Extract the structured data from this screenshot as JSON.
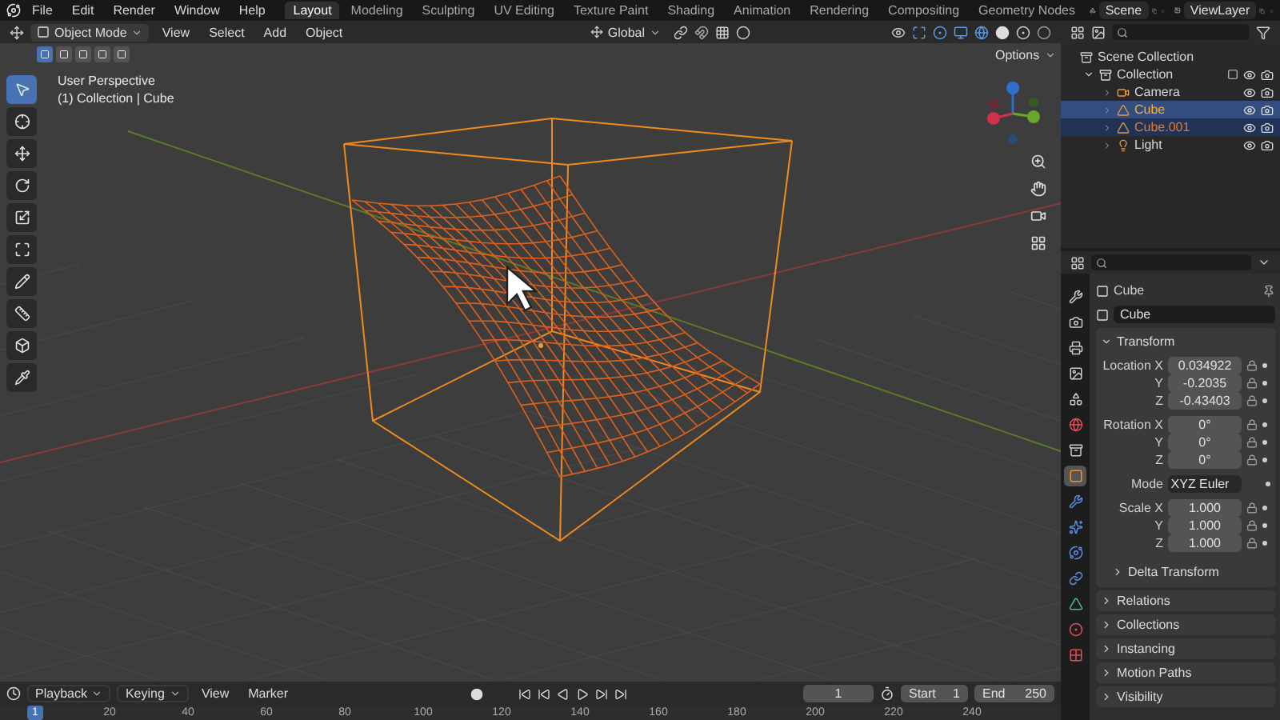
{
  "top_menu": [
    "File",
    "Edit",
    "Render",
    "Window",
    "Help"
  ],
  "workspaces": [
    {
      "label": "Layout",
      "selected": true
    },
    {
      "label": "Modeling",
      "selected": false
    },
    {
      "label": "Sculpting",
      "selected": false
    },
    {
      "label": "UV Editing",
      "selected": false
    },
    {
      "label": "Texture Paint",
      "selected": false
    },
    {
      "label": "Shading",
      "selected": false
    },
    {
      "label": "Animation",
      "selected": false
    },
    {
      "label": "Rendering",
      "selected": false
    },
    {
      "label": "Compositing",
      "selected": false
    },
    {
      "label": "Geometry Nodes",
      "selected": false
    }
  ],
  "scene": "Scene",
  "view_layer": "ViewLayer",
  "viewport_header": {
    "mode": "Object Mode",
    "menus": [
      "View",
      "Select",
      "Add",
      "Object"
    ],
    "orientation": "Global"
  },
  "select_modes": [
    {
      "selected": true
    },
    {
      "selected": false
    },
    {
      "selected": false
    },
    {
      "selected": false
    },
    {
      "selected": false
    }
  ],
  "options": "Options",
  "viewport_info": [
    "User Perspective",
    "(1) Collection | Cube"
  ],
  "tools": [
    {
      "kind": "select",
      "selected": true
    },
    {
      "kind": "cursor",
      "selected": false
    },
    {
      "kind": "move",
      "selected": false
    },
    {
      "kind": "rotate",
      "selected": false
    },
    {
      "kind": "scale",
      "selected": false
    },
    {
      "kind": "transform",
      "selected": false
    },
    {
      "kind": "annotate",
      "selected": false
    },
    {
      "kind": "measure",
      "selected": false
    },
    {
      "kind": "add_cube",
      "selected": false
    },
    {
      "kind": "picker",
      "selected": false
    }
  ],
  "outliner": {
    "root": "Scene Collection",
    "children": [
      {
        "name": "Collection",
        "kind": "collection",
        "expanded": true,
        "children": [
          {
            "name": "Camera",
            "kind": "camera",
            "selected": false,
            "active": false
          },
          {
            "name": "Cube",
            "kind": "mesh",
            "selected": true,
            "active": true
          },
          {
            "name": "Cube.001",
            "kind": "mesh",
            "selected": true,
            "active": false
          },
          {
            "name": "Light",
            "kind": "light",
            "selected": false,
            "active": false
          }
        ]
      }
    ]
  },
  "properties": {
    "tabs": [
      {
        "kind": "tool",
        "selected": false
      },
      {
        "kind": "render",
        "selected": false
      },
      {
        "kind": "output",
        "selected": false
      },
      {
        "kind": "view_layer",
        "selected": false
      },
      {
        "kind": "scene",
        "selected": false
      },
      {
        "kind": "world",
        "selected": false
      },
      {
        "kind": "collection",
        "selected": false
      },
      {
        "kind": "object",
        "selected": true
      },
      {
        "kind": "modifiers",
        "selected": false
      },
      {
        "kind": "particles",
        "selected": false
      },
      {
        "kind": "physics",
        "selected": false
      },
      {
        "kind": "constraints",
        "selected": false
      },
      {
        "kind": "data",
        "selected": false
      },
      {
        "kind": "material",
        "selected": false
      },
      {
        "kind": "texture",
        "selected": false
      }
    ],
    "object_name": "Cube",
    "data_name": "Cube",
    "panel": {
      "title": "Transform",
      "expanded": true,
      "groups": [
        [
          {
            "kind": "number",
            "label": "Location X",
            "value": "0.034922"
          },
          {
            "kind": "number",
            "label": "Y",
            "value": "-0.2035"
          },
          {
            "kind": "number",
            "label": "Z",
            "value": "-0.43403"
          }
        ],
        [
          {
            "kind": "number",
            "label": "Rotation X",
            "value": "0°"
          },
          {
            "kind": "number",
            "label": "Y",
            "value": "0°"
          },
          {
            "kind": "number",
            "label": "Z",
            "value": "0°"
          }
        ],
        [
          {
            "kind": "dropdown",
            "label": "Mode",
            "value": "XYZ Euler"
          }
        ],
        [
          {
            "kind": "number",
            "label": "Scale X",
            "value": "1.000"
          },
          {
            "kind": "number",
            "label": "Y",
            "value": "1.000"
          },
          {
            "kind": "number",
            "label": "Z",
            "value": "1.000"
          }
        ]
      ],
      "subpanels": [
        {
          "title": "Delta Transform",
          "expanded": false
        }
      ]
    },
    "panels": [
      {
        "title": "Relations",
        "expanded": false
      },
      {
        "title": "Collections",
        "expanded": false
      },
      {
        "title": "Instancing",
        "expanded": false
      },
      {
        "title": "Motion Paths",
        "expanded": false
      },
      {
        "title": "Visibility",
        "expanded": false
      }
    ]
  },
  "timeline": {
    "menus": [
      "Playback",
      "Keying",
      "View",
      "Marker"
    ],
    "current_frame": "1",
    "start_label": "Start",
    "start": "1",
    "end_label": "End",
    "end": "250",
    "ruler": [
      "1",
      "20",
      "40",
      "60",
      "80",
      "100",
      "120",
      "140",
      "160",
      "180",
      "200",
      "220",
      "240"
    ]
  }
}
